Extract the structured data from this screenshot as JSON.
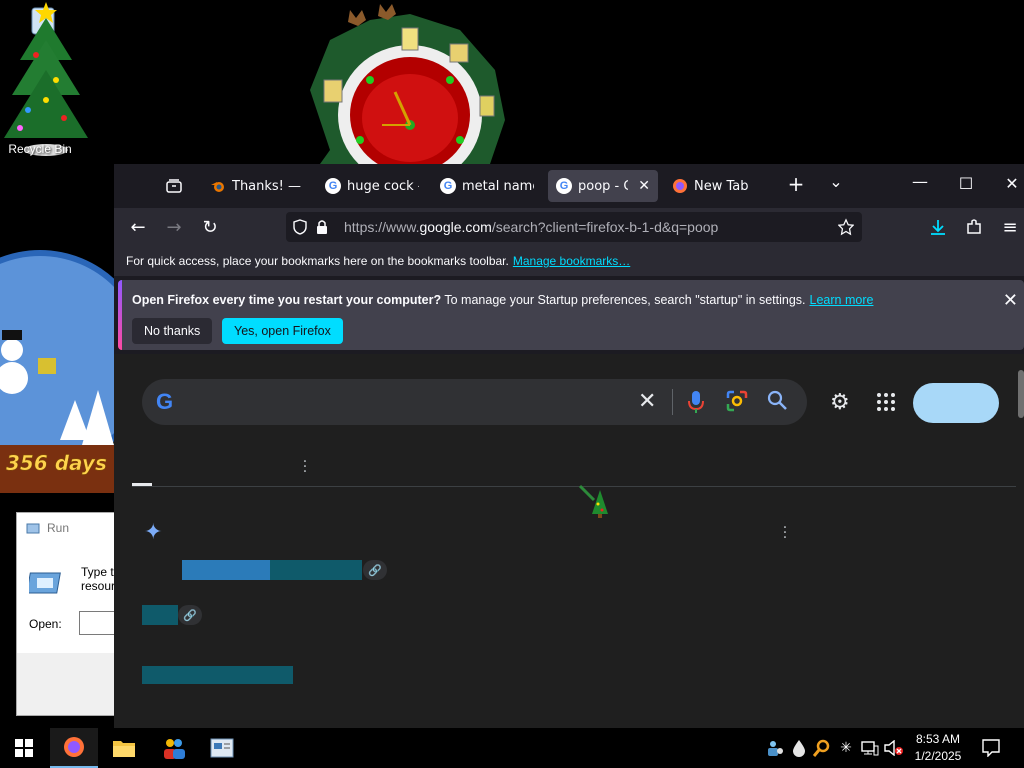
{
  "desktop": {
    "recycle_bin_label": "Recycle Bin",
    "globe_counter": "356 days"
  },
  "run_dialog": {
    "title": "Run",
    "description_line1": "Type th",
    "description_line2": "resour",
    "open_label": "Open:",
    "open_value": ""
  },
  "browser": {
    "tabs": [
      {
        "title": "Thanks! — bl",
        "icon": "blender-icon",
        "active": false
      },
      {
        "title": "huge cock - G",
        "icon": "google-favicon",
        "active": false
      },
      {
        "title": "metal name g",
        "icon": "google-favicon",
        "active": false
      },
      {
        "title": "poop - Goo",
        "icon": "google-favicon",
        "active": true
      },
      {
        "title": "New Tab",
        "icon": "firefox-icon",
        "active": false
      }
    ],
    "url_prefix": "https://www.",
    "url_domain": "google.com",
    "url_rest": "/search?client=firefox-b-1-d&q=poop",
    "bookmarks_bar_text": "For quick access, place your bookmarks here on the bookmarks toolbar.",
    "bookmarks_bar_link": "Manage bookmarks…",
    "notice": {
      "bold": "Open Firefox every time you restart your computer?",
      "text": " To manage your Startup preferences, search \"startup\" in settings.",
      "link": "Learn more",
      "no_label": "No thanks",
      "yes_label": "Yes, open Firefox"
    },
    "google": {
      "logo": "G",
      "search_value": "",
      "accent": "#8ab4f8"
    }
  },
  "taskbar": {
    "time": "8:53 AM",
    "date": "1/2/2025"
  },
  "colors": {
    "firefox_accent": "#00ddff",
    "tab_active_bg": "#42414d",
    "chrome_bg": "#1c1b22"
  }
}
